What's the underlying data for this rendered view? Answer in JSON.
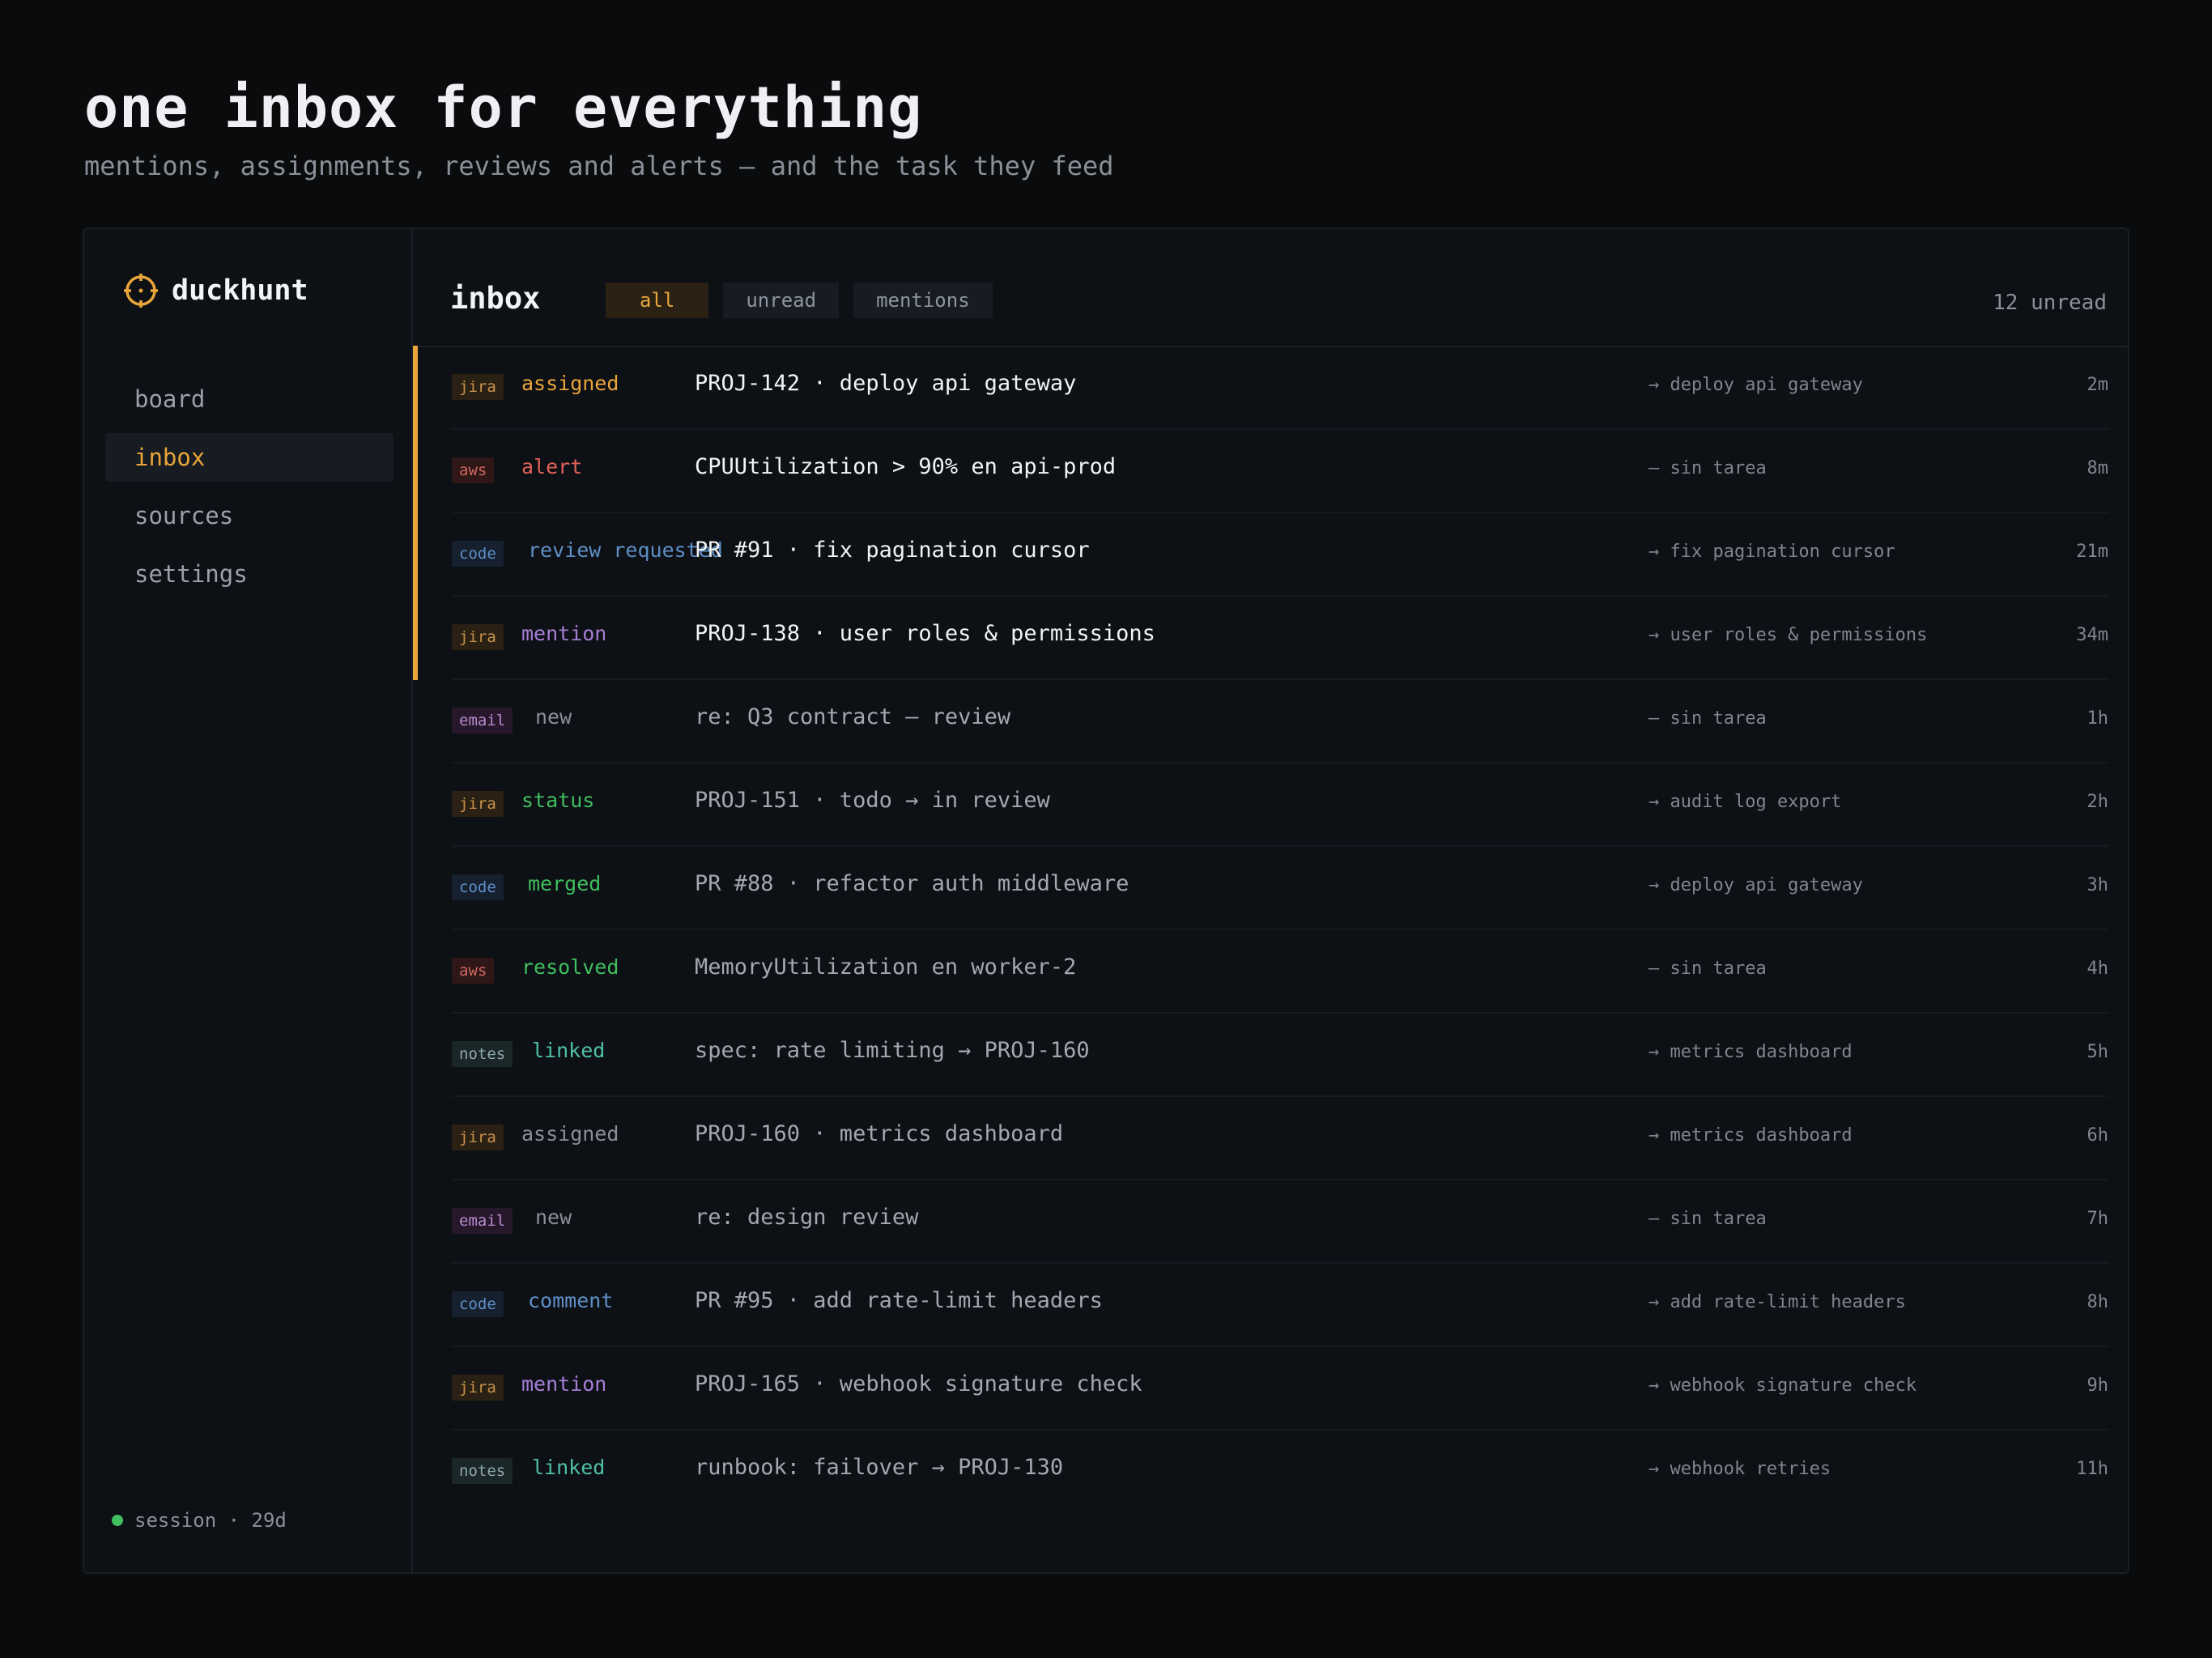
{
  "hero": {
    "title": "one inbox for everything",
    "subtitle": "mentions, assignments, reviews and alerts — and the task they feed"
  },
  "sidebar": {
    "brand": "duckhunt",
    "brand_icon": "crosshair-icon",
    "items": [
      {
        "label": "board"
      },
      {
        "label": "inbox"
      },
      {
        "label": "sources"
      },
      {
        "label": "settings"
      }
    ],
    "active_item": "inbox",
    "session": "session · 29d"
  },
  "main": {
    "title": "inbox",
    "filters": [
      {
        "label": "all"
      },
      {
        "label": "unread"
      },
      {
        "label": "mentions"
      }
    ],
    "active_filter": "all",
    "unread_count": "12 unread"
  },
  "colors": {
    "accent": "#e9a53a",
    "background": "#0a0b0d",
    "panel": "#0d1014",
    "success": "#3fbf5f",
    "danger": "#e0625a"
  },
  "inbox_rows": [
    {
      "source": "jira",
      "kind": "assigned",
      "title": "PROJ-142 · deploy api gateway",
      "task": "→ deploy api gateway",
      "time": "2m",
      "unread": true
    },
    {
      "source": "aws",
      "kind": "alert",
      "title": "CPUUtilization > 90% en api-prod",
      "task": "— sin tarea",
      "time": "8m",
      "unread": true
    },
    {
      "source": "code",
      "kind": "review requested",
      "title": "PR #91 · fix pagination cursor",
      "task": "→ fix pagination cursor",
      "time": "21m",
      "unread": true
    },
    {
      "source": "jira",
      "kind": "mention",
      "title": "PROJ-138 · user roles & permissions",
      "task": "→ user roles & permissions",
      "time": "34m",
      "unread": true
    },
    {
      "source": "email",
      "kind": "new",
      "title": "re: Q3 contract — review",
      "task": "— sin tarea",
      "time": "1h",
      "unread": false
    },
    {
      "source": "jira",
      "kind": "status",
      "title": "PROJ-151 · todo → in review",
      "task": "→ audit log export",
      "time": "2h",
      "unread": false
    },
    {
      "source": "code",
      "kind": "merged",
      "title": "PR #88 · refactor auth middleware",
      "task": "→ deploy api gateway",
      "time": "3h",
      "unread": false
    },
    {
      "source": "aws",
      "kind": "resolved",
      "title": "MemoryUtilization en worker-2",
      "task": "— sin tarea",
      "time": "4h",
      "unread": false
    },
    {
      "source": "notes",
      "kind": "linked",
      "title": "spec: rate limiting → PROJ-160",
      "task": "→ metrics dashboard",
      "time": "5h",
      "unread": false
    },
    {
      "source": "jira",
      "kind": "assigned",
      "title": "PROJ-160 · metrics dashboard",
      "task": "→ metrics dashboard",
      "time": "6h",
      "unread": false
    },
    {
      "source": "email",
      "kind": "new",
      "title": "re: design review",
      "task": "— sin tarea",
      "time": "7h",
      "unread": false
    },
    {
      "source": "code",
      "kind": "comment",
      "title": "PR #95 · add rate-limit headers",
      "task": "→ add rate-limit headers",
      "time": "8h",
      "unread": false
    },
    {
      "source": "jira",
      "kind": "mention",
      "title": "PROJ-165 · webhook signature check",
      "task": "→ webhook signature check",
      "time": "9h",
      "unread": false
    },
    {
      "source": "notes",
      "kind": "linked",
      "title": "runbook: failover → PROJ-130",
      "task": "→ webhook retries",
      "time": "11h",
      "unread": false
    }
  ]
}
